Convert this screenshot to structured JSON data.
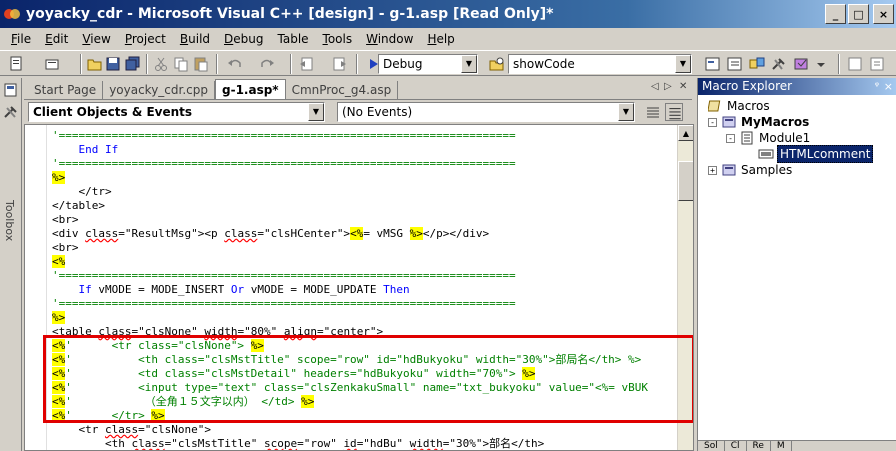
{
  "window": {
    "title": "yoyacky_cdr - Microsoft Visual C++ [design] - g-1.asp [Read Only]*",
    "minimize_glyph": "_",
    "maximize_glyph": "□",
    "close_glyph": "×"
  },
  "menu": [
    {
      "key": "F",
      "rest": "ile"
    },
    {
      "key": "E",
      "rest": "dit"
    },
    {
      "key": "V",
      "rest": "iew"
    },
    {
      "key": "P",
      "rest": "roject"
    },
    {
      "key": "B",
      "rest": "uild"
    },
    {
      "key": "D",
      "rest": "ebug"
    },
    {
      "key": "T",
      "rest": "able",
      "noul": true
    },
    {
      "key": "T",
      "rest": "ools"
    },
    {
      "key": "W",
      "rest": "indow"
    },
    {
      "key": "H",
      "rest": "elp"
    }
  ],
  "toolbar": {
    "config_combo": "Debug",
    "function_combo": "showCode"
  },
  "toolbox": {
    "label": "Toolbox"
  },
  "doc_tabs": [
    {
      "label": "Start Page",
      "active": false
    },
    {
      "label": "yoyacky_cdr.cpp",
      "active": false
    },
    {
      "label": "g-1.asp*",
      "active": true
    },
    {
      "label": "CmnProc_g4.asp",
      "active": false
    }
  ],
  "tab_nav": {
    "left": "◁",
    "right": "▷",
    "close": "✕"
  },
  "code_combos": {
    "objects": "Client Objects & Events",
    "events": "(No Events)"
  },
  "code_lines": [
    [
      {
        "t": "'=====================================================================",
        "c": "cmt"
      }
    ],
    [
      {
        "t": "    "
      },
      {
        "t": "End If",
        "c": "kw"
      }
    ],
    [
      {
        "t": "'=====================================================================",
        "c": "cmt"
      }
    ],
    [
      {
        "t": "%>",
        "c": "hl"
      }
    ],
    [
      {
        "t": "    </tr>"
      }
    ],
    [
      {
        "t": "</table>"
      }
    ],
    [
      {
        "t": "<br>"
      }
    ],
    [
      {
        "t": "<div "
      },
      {
        "t": "class",
        "c": "sq"
      },
      {
        "t": "=\"ResultMsg\"><p "
      },
      {
        "t": "class",
        "c": "sq"
      },
      {
        "t": "=\"clsHCenter\">"
      },
      {
        "t": "<%",
        "c": "hl"
      },
      {
        "t": "= vMSG "
      },
      {
        "t": "%>",
        "c": "hl"
      },
      {
        "t": "</p></div>"
      }
    ],
    [
      {
        "t": "<br>"
      }
    ],
    [
      {
        "t": "<%",
        "c": "hl"
      }
    ],
    [
      {
        "t": "'=====================================================================",
        "c": "cmt"
      }
    ],
    [
      {
        "t": "    "
      },
      {
        "t": "If",
        "c": "kw"
      },
      {
        "t": " vMODE = MODE_INSERT "
      },
      {
        "t": "Or",
        "c": "kw"
      },
      {
        "t": " vMODE = MODE_UPDATE "
      },
      {
        "t": "Then",
        "c": "kw"
      }
    ],
    [
      {
        "t": "'=====================================================================",
        "c": "cmt"
      }
    ],
    [
      {
        "t": "%>",
        "c": "hl"
      }
    ],
    [
      {
        "t": "<table "
      },
      {
        "t": "class",
        "c": "sq"
      },
      {
        "t": "=\"clsNone\" "
      },
      {
        "t": "width",
        "c": "sq"
      },
      {
        "t": "=\"80%\" "
      },
      {
        "t": "align",
        "c": "sq"
      },
      {
        "t": "=\"center\">"
      }
    ],
    [
      {
        "t": "<%",
        "c": "hl"
      },
      {
        "t": "'      <tr class=\"clsNone\"> ",
        "c": "cmt"
      },
      {
        "t": "%>",
        "c": "hl"
      }
    ],
    [
      {
        "t": "<%",
        "c": "hl"
      },
      {
        "t": "'          <th class=\"clsMstTitle\" scope=\"row\" id=\"hdBukyoku\" width=\"30%\">部局名</th> %>",
        "c": "cmt"
      }
    ],
    [
      {
        "t": "<%",
        "c": "hl"
      },
      {
        "t": "'          <td class=\"clsMstDetail\" headers=\"hdBukyoku\" width=\"70%\"> ",
        "c": "cmt"
      },
      {
        "t": "%>",
        "c": "hl"
      }
    ],
    [
      {
        "t": "<%",
        "c": "hl"
      },
      {
        "t": "'          <input type=\"text\" class=\"clsZenkakuSmall\" name=\"txt_bukyoku\" value=\"<%= vBUK",
        "c": "cmt"
      }
    ],
    [
      {
        "t": "<%",
        "c": "hl"
      },
      {
        "t": "'           （全角１５文字以内） </td> ",
        "c": "cmt"
      },
      {
        "t": "%>",
        "c": "hl"
      }
    ],
    [
      {
        "t": "<%",
        "c": "hl"
      },
      {
        "t": "'      </tr> ",
        "c": "cmt"
      },
      {
        "t": "%>",
        "c": "hl"
      }
    ],
    [
      {
        "t": "    <tr "
      },
      {
        "t": "class",
        "c": "sq"
      },
      {
        "t": "=\"clsNone\">"
      }
    ],
    [
      {
        "t": "        <th "
      },
      {
        "t": "class",
        "c": "sq"
      },
      {
        "t": "=\"clsMstTitle\" "
      },
      {
        "t": "scope",
        "c": "sq"
      },
      {
        "t": "=\"row\" "
      },
      {
        "t": "id",
        "c": "sq"
      },
      {
        "t": "=\"hdBu\" "
      },
      {
        "t": "width",
        "c": "sq"
      },
      {
        "t": "=\"30%\">部名</th>"
      }
    ]
  ],
  "macro_explorer": {
    "title": "Macro Explorer",
    "pin_glyph": "ᵠ",
    "close_glyph": "×",
    "nodes": [
      {
        "label": "Macros",
        "level": 0,
        "expander": "",
        "bold": false
      },
      {
        "label": "MyMacros",
        "level": 1,
        "expander": "-",
        "bold": true
      },
      {
        "label": "Module1",
        "level": 2,
        "expander": "-",
        "bold": false
      },
      {
        "label": "HTMLcomment",
        "level": 3,
        "expander": "",
        "bold": false,
        "selected": true
      },
      {
        "label": "Samples",
        "level": 1,
        "expander": "+",
        "bold": false
      }
    ],
    "bottom_tabs": [
      "Sol",
      "Cl",
      "Re",
      "M"
    ]
  },
  "colors": {
    "highlight_box": "#e00000",
    "asp_delimiter_bg": "#ffff00",
    "comment": "#008000",
    "keyword": "#0000ff"
  }
}
